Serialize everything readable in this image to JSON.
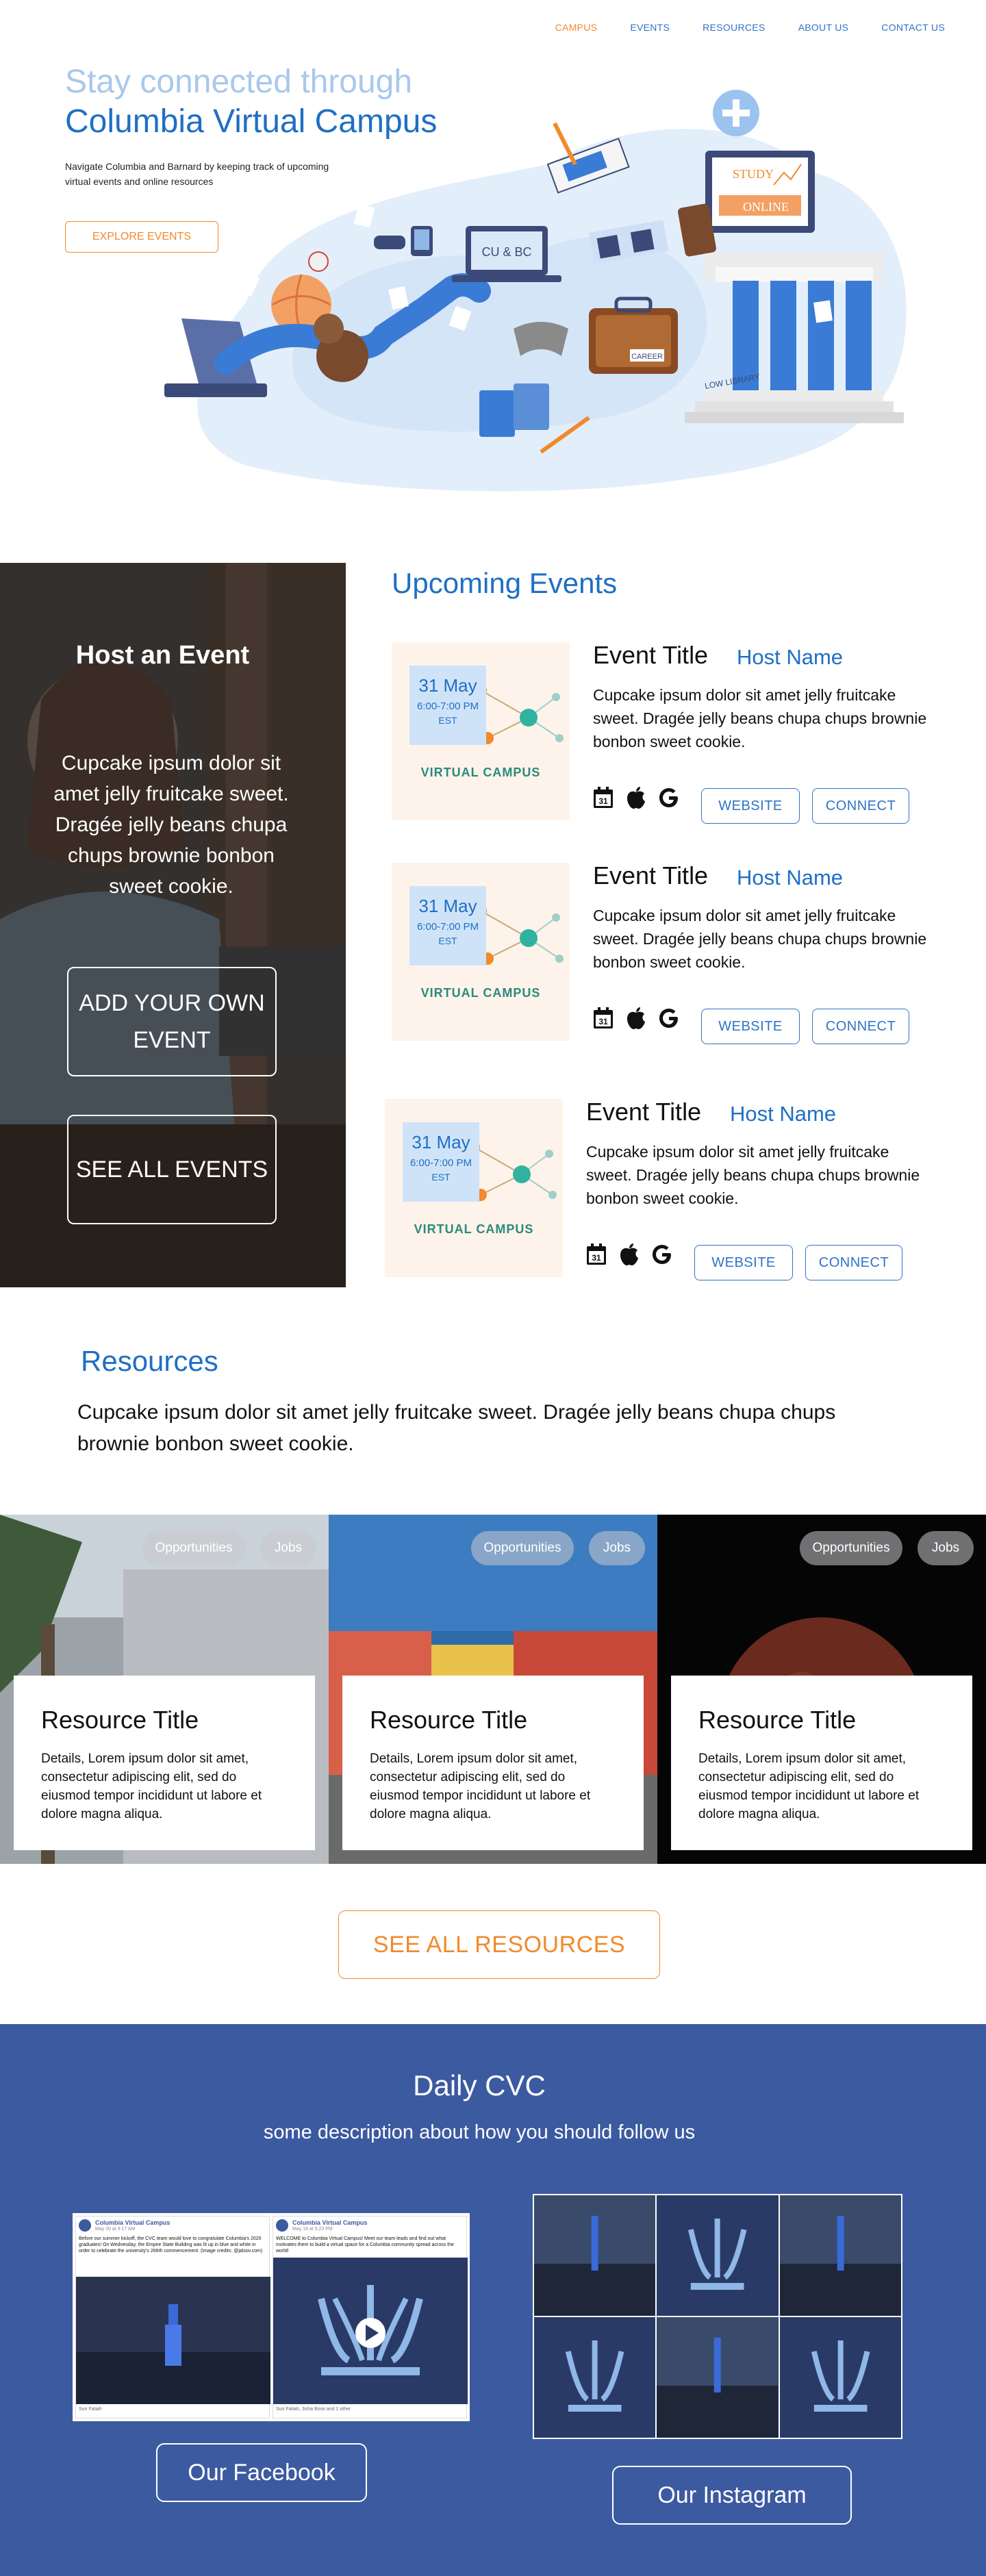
{
  "nav": {
    "items": [
      {
        "label": "CAMPUS",
        "active": true
      },
      {
        "label": "EVENTS",
        "active": false
      },
      {
        "label": "RESOURCES",
        "active": false
      },
      {
        "label": "ABOUT US",
        "active": false
      },
      {
        "label": "CONTACT US",
        "active": false
      }
    ]
  },
  "hero": {
    "title_line1": "Stay connected through",
    "title_line2": "Columbia Virtual Campus",
    "subtitle": "Navigate Columbia and Barnard by keeping track of upcoming virtual events and online resources",
    "cta": "EXPLORE EVENTS",
    "art_labels": {
      "laptop_sticker": "CU & BC",
      "board_line1": "STUDY",
      "board_line2": "ONLINE",
      "building_label": "LOW LIBRARY",
      "suitcase_tag": "CAREER"
    }
  },
  "host": {
    "title": "Host an Event",
    "description": "Cupcake ipsum dolor sit amet jelly fruitcake sweet. Dragée jelly beans chupa chups brownie bonbon sweet cookie.",
    "add_button": "ADD YOUR OWN EVENT",
    "see_all_button": "SEE ALL EVENTS"
  },
  "events": {
    "heading": "Upcoming Events",
    "items": [
      {
        "date": "31 May",
        "time": "6:00-7:00 PM",
        "zone": "EST",
        "brand": "VIRTUAL CAMPUS",
        "title": "Event Title",
        "host": "Host Name",
        "description": "Cupcake ipsum dolor sit amet jelly fruitcake sweet. Dragée jelly beans chupa chups brownie bonbon sweet cookie.",
        "website": "WEBSITE",
        "connect": "CONNECT",
        "calendar_day": "31"
      },
      {
        "date": "31 May",
        "time": "6:00-7:00 PM",
        "zone": "EST",
        "brand": "VIRTUAL CAMPUS",
        "title": "Event Title",
        "host": "Host Name",
        "description": "Cupcake ipsum dolor sit amet jelly fruitcake sweet. Dragée jelly beans chupa chups brownie bonbon sweet cookie.",
        "website": "WEBSITE",
        "connect": "CONNECT",
        "calendar_day": "31"
      },
      {
        "date": "31 May",
        "time": "6:00-7:00 PM",
        "zone": "EST",
        "brand": "VIRTUAL CAMPUS",
        "title": "Event Title",
        "host": "Host Name",
        "description": "Cupcake ipsum dolor sit amet jelly fruitcake sweet. Dragée jelly beans chupa chups brownie bonbon sweet cookie.",
        "website": "WEBSITE",
        "connect": "CONNECT",
        "calendar_day": "31"
      }
    ],
    "icons": [
      "calendar-icon",
      "apple-icon",
      "google-icon"
    ]
  },
  "resources": {
    "heading": "Resources",
    "description": "Cupcake ipsum dolor sit amet jelly fruitcake sweet. Dragée jelly beans chupa chups brownie bonbon sweet cookie.",
    "cards": [
      {
        "title": "Resource Title",
        "details": "Details, Lorem ipsum dolor sit amet, consectetur adipiscing elit, sed do eiusmod tempor incididunt ut labore et dolore magna aliqua.",
        "tag1": "Opportunities",
        "tag2": "Jobs"
      },
      {
        "title": "Resource Title",
        "details": "Details, Lorem ipsum dolor sit amet, consectetur adipiscing elit, sed do eiusmod tempor incididunt ut labore et dolore magna aliqua.",
        "tag1": "Opportunities",
        "tag2": "Jobs"
      },
      {
        "title": "Resource Title",
        "details": "Details, Lorem ipsum dolor sit amet, consectetur adipiscing elit, sed do eiusmod tempor incididunt ut labore et dolore magna aliqua.",
        "tag1": "Opportunities",
        "tag2": "Jobs"
      }
    ],
    "see_all": "SEE ALL RESOURCES"
  },
  "daily": {
    "title": "Daily CVC",
    "subtitle": "some description about how you should follow us",
    "facebook_button": "Our Facebook",
    "instagram_button": "Our Instagram",
    "fb_posts": [
      {
        "page": "Columbia Virtual Campus",
        "meta": "May 20 at 9:17 AM",
        "text": "Before our summer kickoff, the CVC team would love to congratulate Columbia's 2020 graduates! On Wednesday, the Empire State Building was lit up in blue and white in order to celebrate the university's 266th commencement. (Image credits: @jalsov.com)",
        "footer": "Suri Fatiah"
      },
      {
        "page": "Columbia Virtual Campus",
        "meta": "May 19 at 5:23 PM",
        "text": "WELCOME to Columbia Virtual Campus! Meet our team leads and find out what motivates them to build a virtual space for a Columbia community spread across the world!",
        "footer": "Suri Fatiah, Jisha Bose and 1 other"
      }
    ]
  },
  "colors": {
    "brand_blue": "#1f6fc4",
    "accent_orange": "#f08a2c",
    "footer_blue": "#3c5aa0",
    "light_blue": "#a9c8ec"
  }
}
